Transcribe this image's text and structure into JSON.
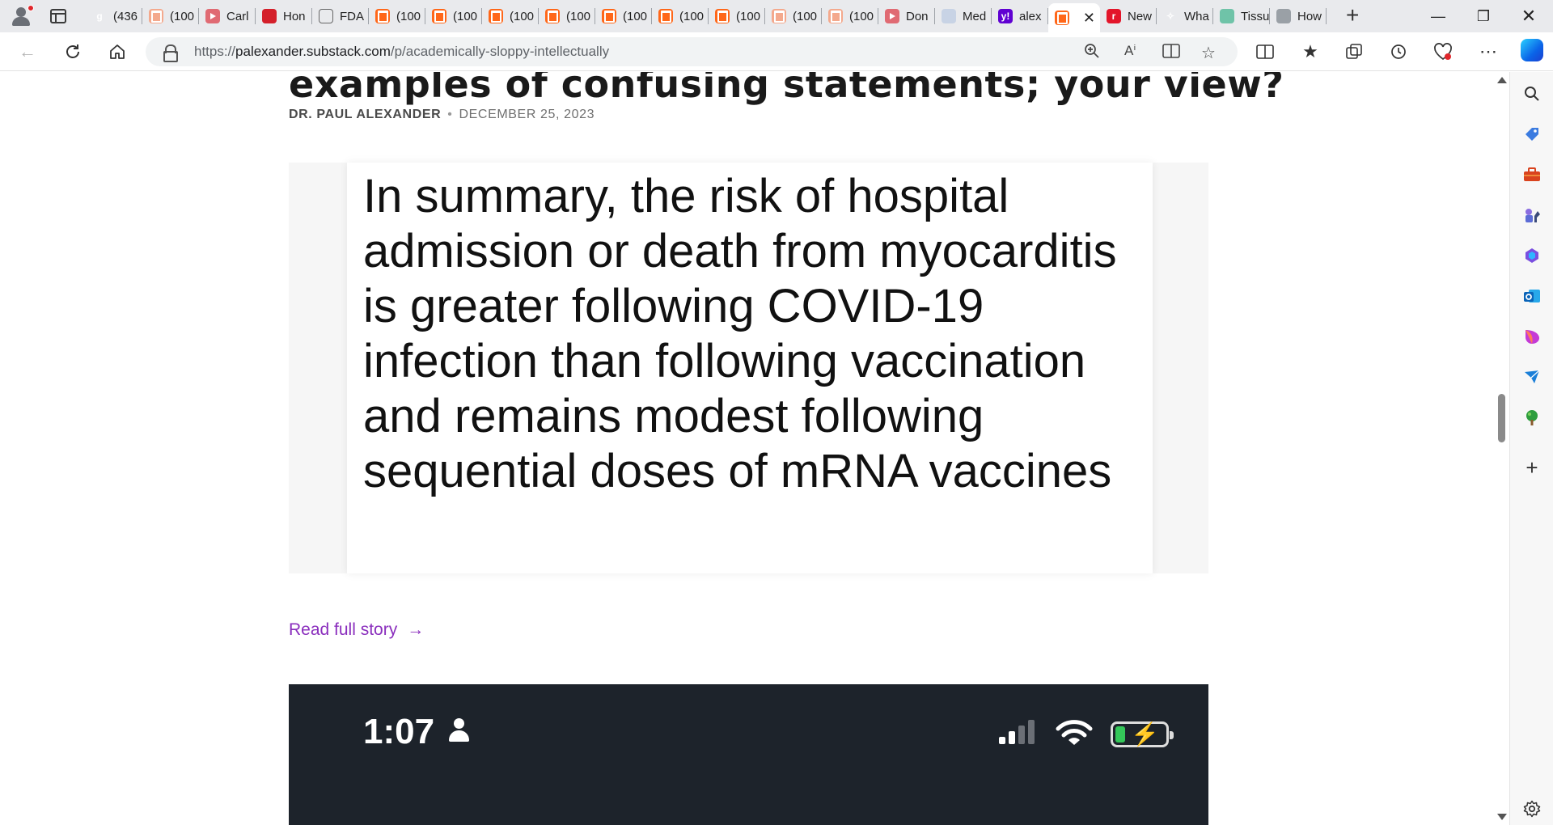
{
  "browser": {
    "tabs": [
      {
        "title": "(436",
        "favicon": "g-icon"
      },
      {
        "title": "(100",
        "favicon": "substack-icon"
      },
      {
        "title": "Carl",
        "favicon": "youtube-icon"
      },
      {
        "title": "Hon",
        "favicon": "honey-icon"
      },
      {
        "title": "FDA",
        "favicon": "document-icon"
      },
      {
        "title": "(100",
        "favicon": "substack-icon"
      },
      {
        "title": "(100",
        "favicon": "substack-icon"
      },
      {
        "title": "(100",
        "favicon": "substack-icon"
      },
      {
        "title": "(100",
        "favicon": "substack-icon"
      },
      {
        "title": "(100",
        "favicon": "substack-icon"
      },
      {
        "title": "(100",
        "favicon": "substack-icon"
      },
      {
        "title": "(100",
        "favicon": "substack-icon"
      },
      {
        "title": "(100",
        "favicon": "substack-icon"
      },
      {
        "title": "(100",
        "favicon": "substack-icon"
      },
      {
        "title": "Don",
        "favicon": "youtube-icon"
      },
      {
        "title": "Med",
        "favicon": "medical-icon"
      },
      {
        "title": "alex",
        "favicon": "yahoo-icon"
      },
      {
        "title": "",
        "favicon": "substack-icon",
        "active": true
      },
      {
        "title": "New",
        "favicon": "news-icon"
      },
      {
        "title": "Wha",
        "favicon": "sparkle-icon"
      },
      {
        "title": "Tissu",
        "favicon": "leaf-icon"
      },
      {
        "title": "How",
        "favicon": "globe-icon"
      }
    ],
    "url_prefix": "https://",
    "url_host": "palexander.substack.com",
    "url_path": "/p/academically-sloppy-intellectually",
    "colors": {
      "accent": "#ff6719",
      "link": "#8a2ebd",
      "tabstrip": "#e9eaed"
    }
  },
  "article": {
    "title": "examples of confusing statements; your view?",
    "author": "DR. PAUL ALEXANDER",
    "separator": "•",
    "date": "DECEMBER 25, 2023",
    "quote_lines": [
      "In summary, the risk of hospital",
      "admission or death from myocarditis",
      "is greater following COVID-19",
      "infection than following vaccination",
      "and remains modest following",
      "sequential doses of mRNA vaccines"
    ],
    "read_more": "Read full story",
    "read_more_arrow": "→",
    "phone": {
      "time": "1:07"
    }
  }
}
